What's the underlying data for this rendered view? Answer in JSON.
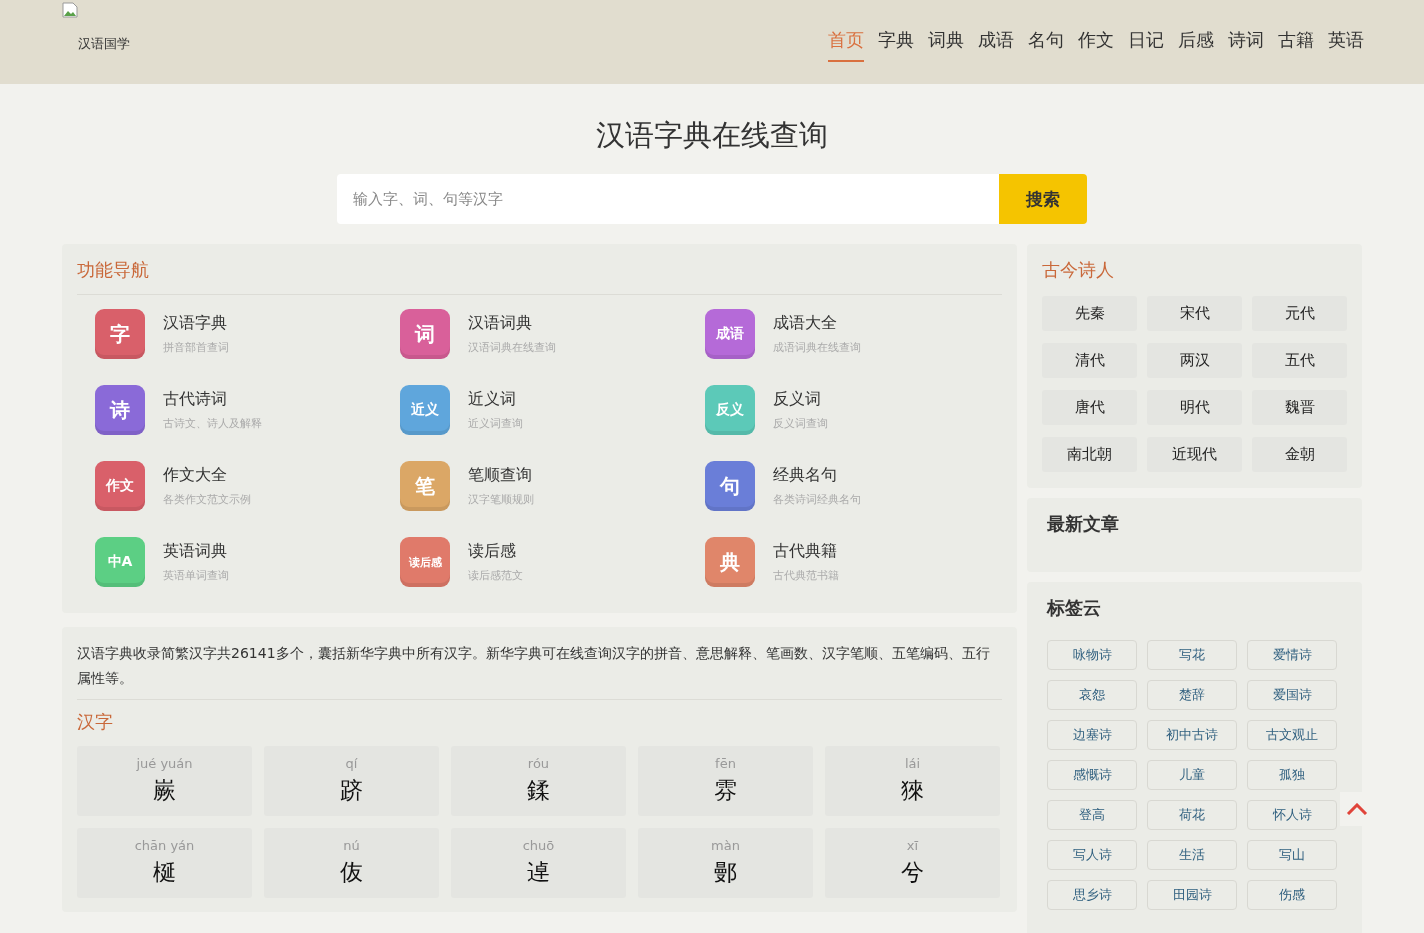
{
  "header": {
    "logo_text": "汉语国学",
    "nav": [
      {
        "label": "首页",
        "selected": true
      },
      {
        "label": "字典",
        "selected": false
      },
      {
        "label": "词典",
        "selected": false
      },
      {
        "label": "成语",
        "selected": false
      },
      {
        "label": "名句",
        "selected": false
      },
      {
        "label": "作文",
        "selected": false
      },
      {
        "label": "日记",
        "selected": false
      },
      {
        "label": "后感",
        "selected": false
      },
      {
        "label": "诗词",
        "selected": false
      },
      {
        "label": "古籍",
        "selected": false
      },
      {
        "label": "英语",
        "selected": false
      }
    ]
  },
  "hero": {
    "title": "汉语字典在线查询",
    "search": {
      "placeholder": "输入字、词、句等汉字",
      "button": "搜索"
    }
  },
  "features": {
    "title": "功能导航",
    "items": [
      {
        "glyph": "字",
        "color": "#d9606a",
        "name": "汉语字典",
        "desc": "拼音部首查词"
      },
      {
        "glyph": "词",
        "color": "#d9609a",
        "name": "汉语词典",
        "desc": "汉语词典在线查询"
      },
      {
        "glyph": "成语",
        "color": "#b56ad8",
        "name": "成语大全",
        "desc": "成语词典在线查询"
      },
      {
        "glyph": "诗",
        "color": "#8a6ad8",
        "name": "古代诗词",
        "desc": "古诗文、诗人及解释"
      },
      {
        "glyph": "近义",
        "color": "#5fa6dc",
        "name": "近义词",
        "desc": "近义词查询"
      },
      {
        "glyph": "反义",
        "color": "#5cc9b8",
        "name": "反义词",
        "desc": "反义词查询"
      },
      {
        "glyph": "作文",
        "color": "#d9606a",
        "name": "作文大全",
        "desc": "各类作文范文示例"
      },
      {
        "glyph": "笔",
        "color": "#dba766",
        "name": "笔顺查询",
        "desc": "汉字笔顺规则"
      },
      {
        "glyph": "句",
        "color": "#6a7ed8",
        "name": "经典名句",
        "desc": "各类诗词经典名句"
      },
      {
        "glyph": "中A",
        "color": "#5ccf84",
        "name": "英语词典",
        "desc": "英语单词查询"
      },
      {
        "glyph": "读后感",
        "color": "#e07a6a",
        "name": "读后感",
        "desc": "读后感范文"
      },
      {
        "glyph": "典",
        "color": "#e0866a",
        "name": "古代典籍",
        "desc": "古代典范书籍"
      }
    ]
  },
  "intro": {
    "text": "汉语字典收录简繁汉字共26141多个，囊括新华字典中所有汉字。新华字典可在线查询汉字的拼音、意思解释、笔画数、汉字笔顺、五笔编码、五行属性等。",
    "section_title": "汉字",
    "chars": [
      {
        "pinyin": "jué yuán",
        "char": "嶡"
      },
      {
        "pinyin": "qí",
        "char": "跻"
      },
      {
        "pinyin": "róu",
        "char": "鍒"
      },
      {
        "pinyin": "fēn",
        "char": "雰"
      },
      {
        "pinyin": "lái",
        "char": "猍"
      },
      {
        "pinyin": "chān yán",
        "char": "梴"
      },
      {
        "pinyin": "nú",
        "char": "伖"
      },
      {
        "pinyin": "chuō",
        "char": "逴"
      },
      {
        "pinyin": "màn",
        "char": "鄤"
      },
      {
        "pinyin": "xī",
        "char": "兮"
      }
    ]
  },
  "poets": {
    "title": "古今诗人",
    "items": [
      "先秦",
      "宋代",
      "元代",
      "清代",
      "两汉",
      "五代",
      "唐代",
      "明代",
      "魏晋",
      "南北朝",
      "近现代",
      "金朝"
    ]
  },
  "latest": {
    "title": "最新文章"
  },
  "tags": {
    "title": "标签云",
    "items": [
      "咏物诗",
      "写花",
      "爱情诗",
      "哀怨",
      "楚辞",
      "爱国诗",
      "边塞诗",
      "初中古诗",
      "古文观止",
      "感慨诗",
      "儿童",
      "孤独",
      "登高",
      "荷花",
      "怀人诗",
      "写人诗",
      "生活",
      "写山",
      "思乡诗",
      "田园诗",
      "伤感"
    ]
  }
}
